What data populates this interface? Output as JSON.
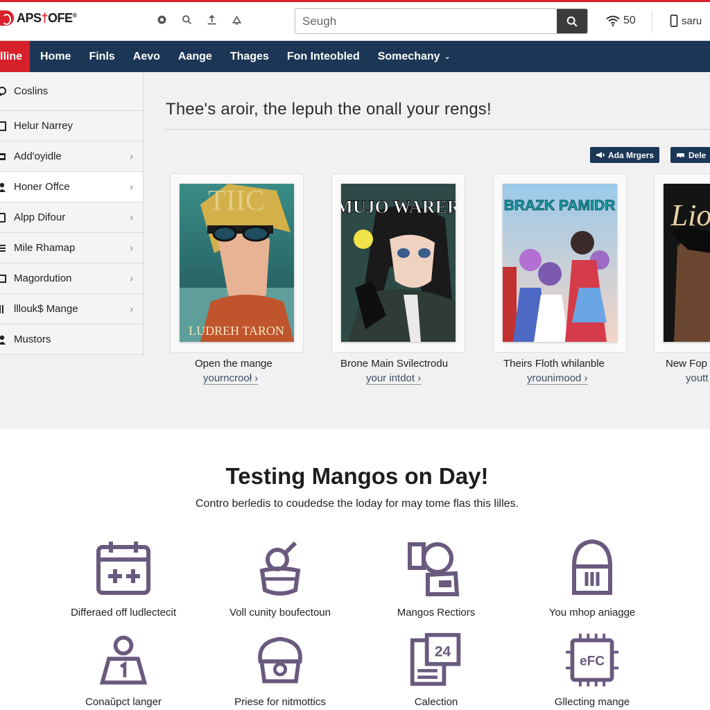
{
  "header": {
    "logo_text_a": "APS",
    "logo_text_b": "†",
    "logo_text_c": "OFE",
    "logo_reg": "®",
    "icons": [
      "settings-icon",
      "search-icon",
      "upload-icon",
      "bell-icon"
    ],
    "search_placeholder": "Seugh",
    "wifi_value": "50",
    "user_label": "saru"
  },
  "nav": {
    "items": [
      {
        "label": "lline",
        "active": true
      },
      {
        "label": "Home"
      },
      {
        "label": "Finls"
      },
      {
        "label": "Aevo"
      },
      {
        "label": "Aange"
      },
      {
        "label": "Thages"
      },
      {
        "label": "Fon Inteobled"
      },
      {
        "label": "Somechany",
        "dropdown": true
      }
    ]
  },
  "sidebar": {
    "items": [
      {
        "label": "Coslins",
        "icon": "chat-bubble-icon"
      },
      {
        "label": "Helur Narrey",
        "icon": "list-icon"
      },
      {
        "label": "Add'oyidle",
        "icon": "folder-icon",
        "chevron": true
      },
      {
        "label": "Honer Offce",
        "icon": "user-icon",
        "chevron": true
      },
      {
        "label": "Alpp Difour",
        "icon": "device-icon",
        "chevron": true
      },
      {
        "label": "Mile Rhamap",
        "icon": "list-icon",
        "chevron": true
      },
      {
        "label": "Magordution",
        "icon": "device-icon",
        "chevron": true
      },
      {
        "label": "lllouk$ Mange",
        "icon": "list-icon",
        "chevron": true
      },
      {
        "label": "Mustors",
        "icon": "user-icon"
      }
    ]
  },
  "main": {
    "headline": "Thee's aroir, the lepuh the onall your rengs!",
    "buttons": [
      {
        "label": "Ada Mrgers",
        "icon": "megaphone-icon"
      },
      {
        "label": "Dele",
        "icon": "car-icon"
      }
    ],
    "cards": [
      {
        "title": "Open the mange",
        "link": "yourncrooł ›",
        "cover_text": "LUDREH TARON",
        "cover_top": "TIIC"
      },
      {
        "title": "Brone Main Svilectrodu",
        "link": "your intdot ›",
        "cover_text": "MUJO WARER"
      },
      {
        "title": "Theirs Floth whilanble",
        "link": "yrounimood ›",
        "cover_text": "BRAZK PAMIDR"
      },
      {
        "title": "New Fop",
        "link": "youtt",
        "cover_text": "Lio"
      }
    ]
  },
  "features": {
    "title": "Testing Mangos on Day!",
    "subtitle": "Contro berledis to coudedse the loday for may tome flas this lilles.",
    "items": [
      {
        "label": "Differaed off ludlectecit",
        "icon": "calendar-icon"
      },
      {
        "label": "Voll cunity boufectoun",
        "icon": "bowl-icon"
      },
      {
        "label": "Mangos Rectiors",
        "icon": "camera-icon"
      },
      {
        "label": "You mhop aniagge",
        "icon": "helmet-icon"
      },
      {
        "label": "Conaǔpct langer",
        "icon": "badge-person-icon"
      },
      {
        "label": "Priese for nitmottics",
        "icon": "chef-icon"
      },
      {
        "label": "Calection",
        "icon": "calculator-icon"
      },
      {
        "label": "Gllecting mange",
        "icon": "chip-icon"
      }
    ]
  },
  "colors": {
    "brand_red": "#d6202a",
    "nav_navy": "#1c3656",
    "icon_purple": "#6a5a7e"
  }
}
